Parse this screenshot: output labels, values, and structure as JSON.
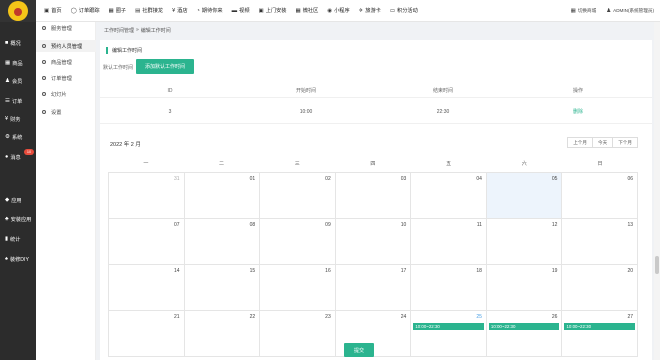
{
  "topnav": [
    {
      "icon": "home-icon",
      "glyph": "▣",
      "label": "首页"
    },
    {
      "icon": "order-icon",
      "glyph": "◯",
      "label": "订单跟踪"
    },
    {
      "icon": "circle-icon",
      "glyph": "▦",
      "label": "圈子"
    },
    {
      "icon": "community-icon",
      "glyph": "▤",
      "label": "社群接龙"
    },
    {
      "icon": "hotel-icon",
      "glyph": "¥",
      "label": "酒店"
    },
    {
      "icon": "schedule-icon",
      "glyph": "◔",
      "label": "期待你来"
    },
    {
      "icon": "video-icon",
      "glyph": "▬",
      "label": "视频"
    },
    {
      "icon": "door-icon",
      "glyph": "▣",
      "label": "上门安装"
    },
    {
      "icon": "community2-icon",
      "glyph": "▦",
      "label": "微社区"
    },
    {
      "icon": "miniapp-icon",
      "glyph": "◉",
      "label": "小程序"
    },
    {
      "icon": "card-icon",
      "glyph": "✈",
      "label": "旅游卡"
    },
    {
      "icon": "points-icon",
      "glyph": "▭",
      "label": "积分活动"
    }
  ],
  "topright": {
    "switch_label": "切换商城",
    "user_label": "ADMIN(系统管理员)"
  },
  "sidebar": [
    {
      "icon": "overview-icon",
      "glyph": "■",
      "label": "概况"
    },
    {
      "icon": "goods-icon",
      "glyph": "▦",
      "label": "商品"
    },
    {
      "icon": "member-icon",
      "glyph": "♟",
      "label": "会员"
    },
    {
      "icon": "order-icon",
      "glyph": "☰",
      "label": "订单"
    },
    {
      "icon": "finance-icon",
      "glyph": "¥",
      "label": "财务"
    },
    {
      "icon": "system-icon",
      "glyph": "⚙",
      "label": "系统"
    },
    {
      "icon": "message-icon",
      "glyph": "●",
      "label": "消息",
      "badge": "10"
    },
    {
      "icon": "app-icon",
      "glyph": "◆",
      "label": "应用"
    },
    {
      "icon": "install-icon",
      "glyph": "♣",
      "label": "安装应用"
    },
    {
      "icon": "stats-icon",
      "glyph": "▮",
      "label": "统计"
    },
    {
      "icon": "decorate-icon",
      "glyph": "♠",
      "label": "装修DIY"
    }
  ],
  "subsidebar": [
    {
      "label": "服务管理",
      "active": false
    },
    {
      "label": "预约人员管理",
      "active": true
    },
    {
      "label": "商品管理",
      "active": false
    },
    {
      "label": "订单管理",
      "active": false
    },
    {
      "label": "幻灯片",
      "active": false
    },
    {
      "label": "设置",
      "active": false
    }
  ],
  "breadcrumb": {
    "parent": "工作时间管理",
    "sep": "»",
    "current": "编辑工作时间"
  },
  "section_title": "编辑工作时间",
  "default_label": "默认工作时间",
  "add_default_button": "添加默认工作时间",
  "table": {
    "headers": [
      "ID",
      "开始时间",
      "结束时间",
      "操作"
    ],
    "rows": [
      {
        "id": "3",
        "start": "10:00",
        "end": "22:30",
        "action": "删除"
      }
    ]
  },
  "calendar": {
    "month_label": "2022 年 2 月",
    "nav": [
      "上个月",
      "今天",
      "下个月"
    ],
    "weekdays": [
      "一",
      "二",
      "三",
      "四",
      "五",
      "六",
      "日"
    ],
    "weeks": [
      [
        {
          "d": "31",
          "other": true
        },
        {
          "d": "01"
        },
        {
          "d": "02"
        },
        {
          "d": "03"
        },
        {
          "d": "04"
        },
        {
          "d": "05",
          "today": true
        },
        {
          "d": "06"
        }
      ],
      [
        {
          "d": "07"
        },
        {
          "d": "08"
        },
        {
          "d": "09"
        },
        {
          "d": "10"
        },
        {
          "d": "11"
        },
        {
          "d": "12"
        },
        {
          "d": "13"
        }
      ],
      [
        {
          "d": "14"
        },
        {
          "d": "15"
        },
        {
          "d": "16"
        },
        {
          "d": "17"
        },
        {
          "d": "18"
        },
        {
          "d": "19"
        },
        {
          "d": "20"
        }
      ],
      [
        {
          "d": "21"
        },
        {
          "d": "22"
        },
        {
          "d": "23"
        },
        {
          "d": "24"
        },
        {
          "d": "25",
          "today_num": true,
          "event": "10:00~22:30"
        },
        {
          "d": "26",
          "event": "10:00~22:30"
        },
        {
          "d": "27",
          "event": "10:00~22:30"
        }
      ]
    ]
  },
  "submit_button": "提交",
  "colors": {
    "accent": "#2bb48f",
    "sidebar_bg": "#2c2c2c",
    "today_bg": "#edf4fc"
  }
}
